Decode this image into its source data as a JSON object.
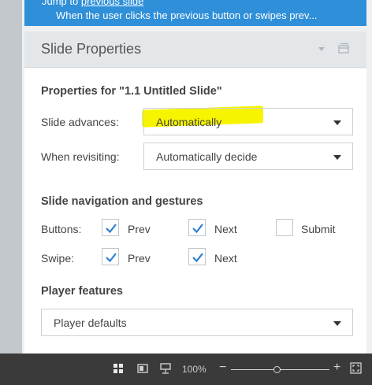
{
  "trigger": {
    "prefix": "Jump to",
    "link": "previous slide",
    "condition": "When the user clicks the previous button or swipes prev..."
  },
  "section": {
    "title": "Slide Properties"
  },
  "properties": {
    "heading": "Properties for \"1.1 Untitled Slide\"",
    "slide_advances_label": "Slide advances:",
    "slide_advances_value": "Automatically",
    "when_revisiting_label": "When revisiting:",
    "when_revisiting_value": "Automatically decide"
  },
  "navigation": {
    "heading": "Slide navigation and gestures",
    "buttons_label": "Buttons:",
    "buttons": [
      {
        "label": "Prev",
        "checked": true
      },
      {
        "label": "Next",
        "checked": true
      },
      {
        "label": "Submit",
        "checked": false
      }
    ],
    "swipe_label": "Swipe:",
    "swipe": [
      {
        "label": "Prev",
        "checked": true
      },
      {
        "label": "Next",
        "checked": true
      }
    ]
  },
  "player": {
    "heading": "Player features",
    "value": "Player defaults"
  },
  "statusbar": {
    "zoom": "100%",
    "minus": "−",
    "plus": "+",
    "zoom_level": 0.47,
    "icons": [
      "normal-view-icon",
      "reading-view-icon",
      "slide-sorter-icon",
      "fit-window-icon"
    ]
  },
  "colors": {
    "accent_blue": "#2f8fd8",
    "check_blue": "#2d7fd0",
    "highlight_yellow": "#f7f400",
    "statusbar_bg": "#3a3a3a"
  }
}
